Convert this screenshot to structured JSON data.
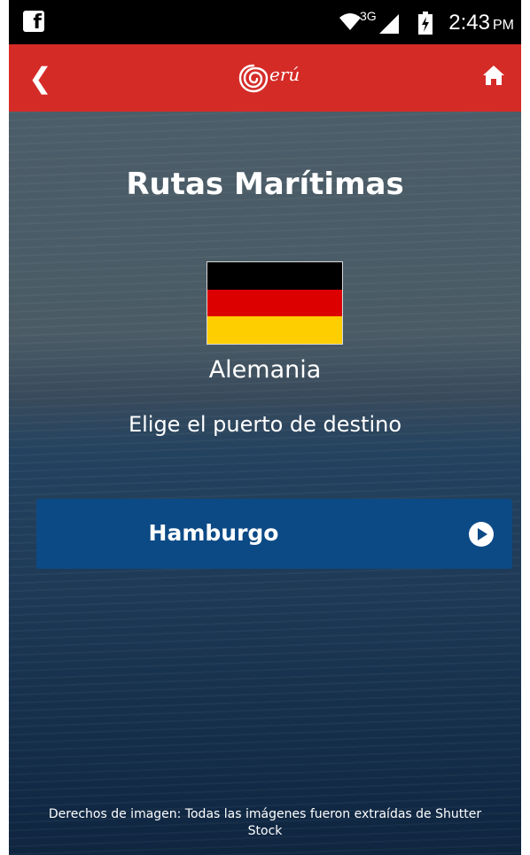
{
  "status_bar": {
    "app_icon": "facebook-icon",
    "network_type": "3G",
    "time": "2:43",
    "period": "PM",
    "icons": [
      "wifi-icon",
      "cell-signal-icon",
      "battery-charging-icon"
    ]
  },
  "header": {
    "back_icon": "chevron-left-icon",
    "logo_text": "erú",
    "home_icon": "home-icon",
    "color": "#d52b27"
  },
  "main": {
    "title": "Rutas Marítimas",
    "country": {
      "name": "Alemania",
      "flag_colors": [
        "#000000",
        "#dd0000",
        "#ffce00"
      ]
    },
    "prompt": "Elige el puerto de destino",
    "ports": [
      {
        "label": "Hamburgo",
        "icon": "play-circle-icon",
        "color": "#0c4a86"
      }
    ]
  },
  "footer": {
    "credits": "Derechos de imagen: Todas las imágenes fueron extraídas de Shutter Stock"
  }
}
